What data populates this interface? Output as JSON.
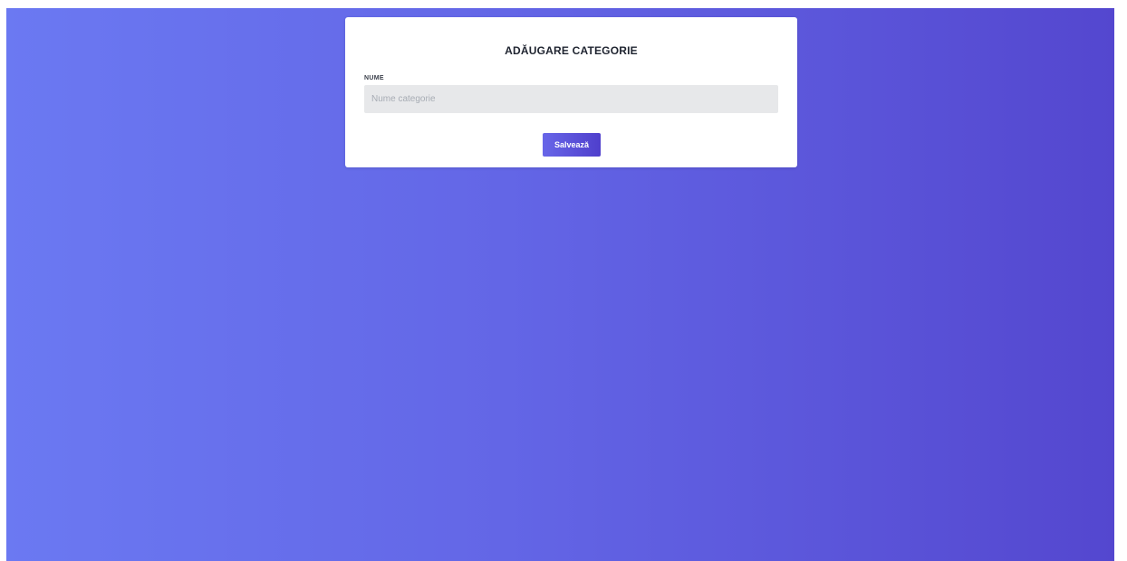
{
  "form": {
    "title": "ADĂUGARE CATEGORIE",
    "name_label": "NUME",
    "name_placeholder": "Nume categorie",
    "name_value": "",
    "save_label": "Salvează"
  },
  "colors": {
    "background_gradient_start": "#6b79f2",
    "background_gradient_end": "#5447cf",
    "button_gradient_start": "#6866e8",
    "button_gradient_end": "#4f3fcc",
    "input_background": "#e7e8ea"
  }
}
